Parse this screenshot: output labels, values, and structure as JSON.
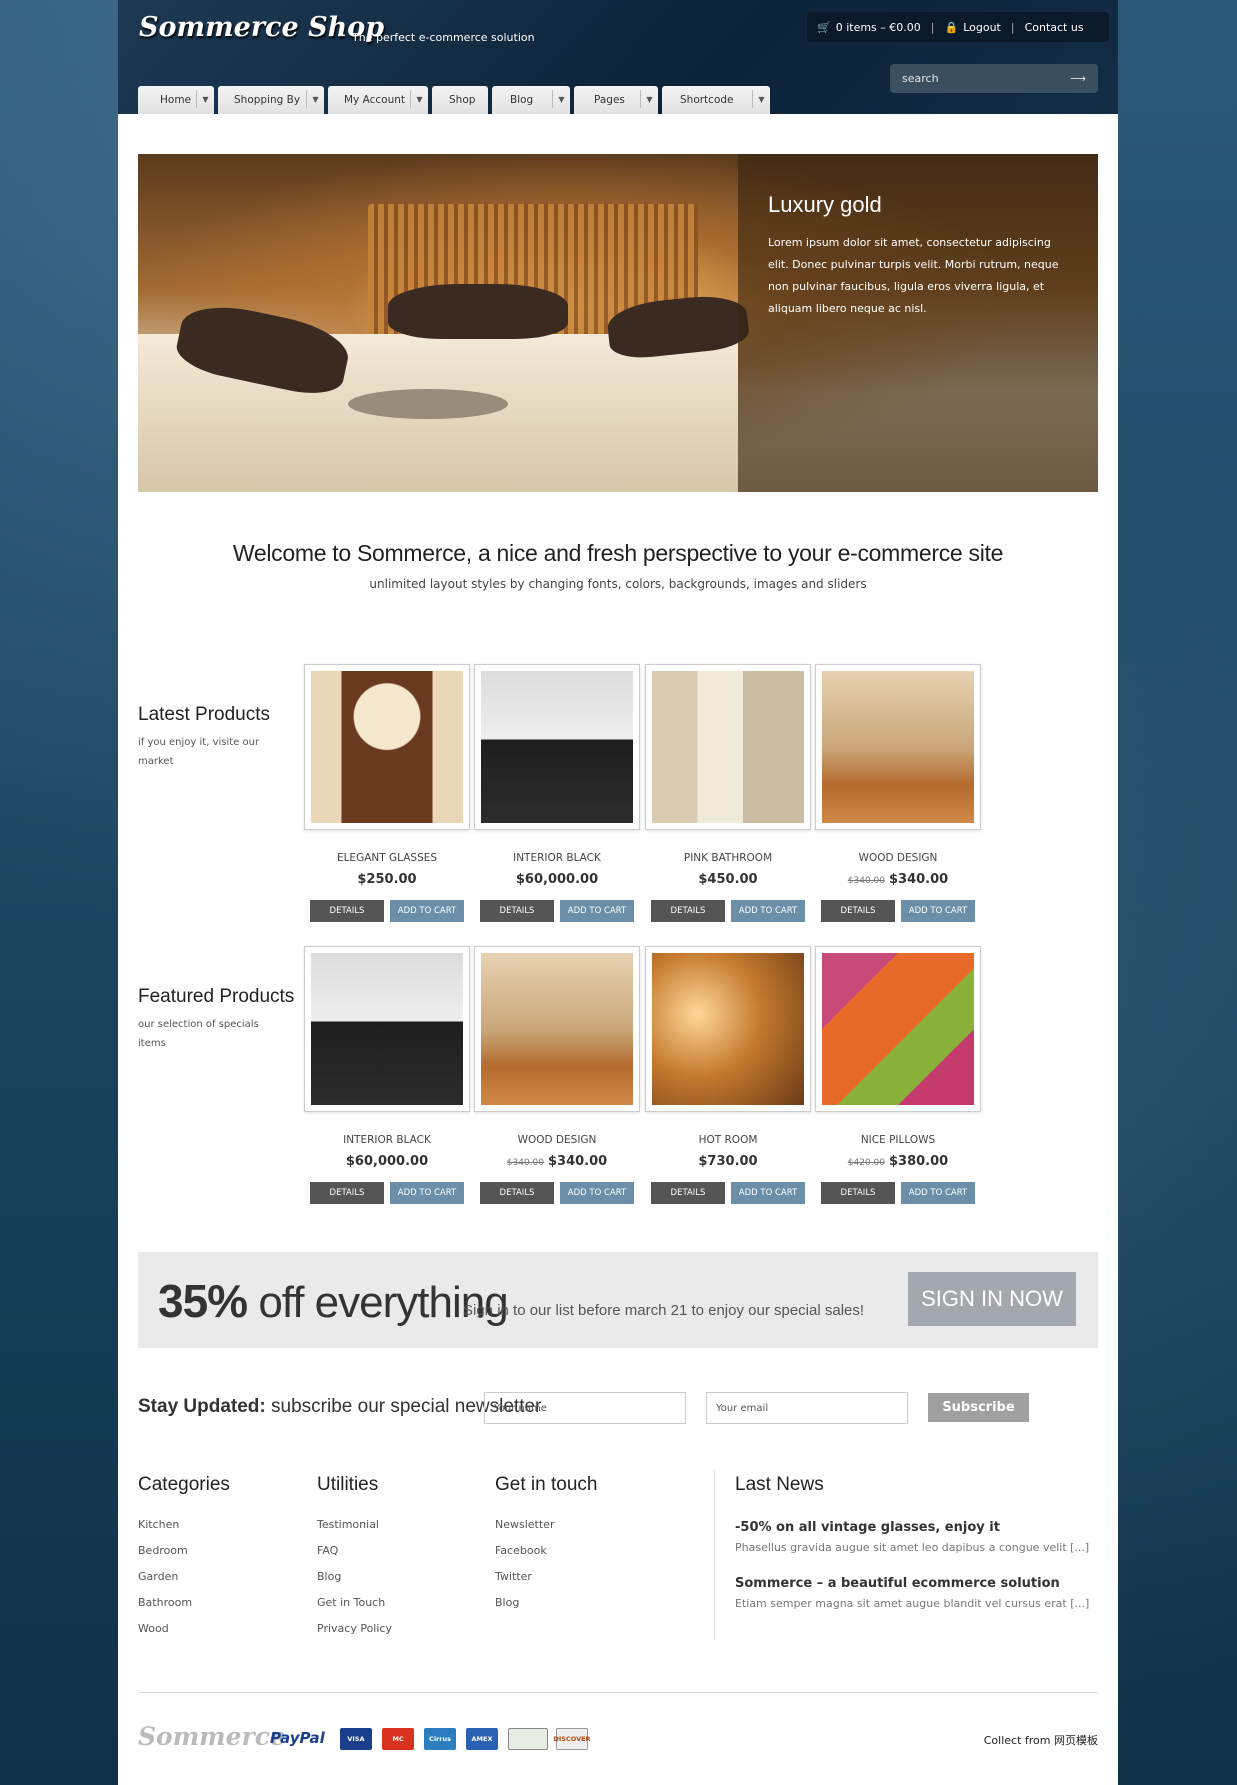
{
  "header": {
    "logo": "Sommerce Shop",
    "tagline": "The perfect e-commerce solution",
    "cart": "0 items – €0.00",
    "logout": "Logout",
    "contact": "Contact us",
    "search_placeholder": "search"
  },
  "nav": [
    "Home",
    "Shopping By",
    "My Account",
    "Shop",
    "Blog",
    "Pages",
    "Shortcode"
  ],
  "slider": {
    "title": "Luxury gold",
    "text": "Lorem ipsum dolor sit amet, consectetur adipiscing elit. Donec pulvinar turpis velit. Morbi rutrum, neque non pulvinar faucibus, ligula eros viverra ligula, et aliquam libero neque ac nisl."
  },
  "welcome": {
    "title": "Welcome to Sommerce, a nice and fresh perspective to your e-commerce site",
    "subtitle": "unlimited layout styles by changing fonts, colors, backgrounds, images and sliders"
  },
  "latest": {
    "title": "Latest Products",
    "subtitle": "if you enjoy it, visite our market",
    "items": [
      {
        "name": "ELEGANT GLASSES",
        "old": "",
        "price": "$250.00",
        "icon": "mirror-sink-image"
      },
      {
        "name": "INTERIOR BLACK",
        "old": "",
        "price": "$60,000.00",
        "icon": "black-bed-image"
      },
      {
        "name": "PINK BATHROOM",
        "old": "",
        "price": "$450.00",
        "icon": "bathroom-image"
      },
      {
        "name": "WOOD DESIGN",
        "old": "$340.00",
        "price": "$340.00",
        "icon": "living-room-image"
      }
    ]
  },
  "featured": {
    "title": "Featured Products",
    "subtitle": "our selection of specials items",
    "items": [
      {
        "name": "INTERIOR BLACK",
        "old": "",
        "price": "$60,000.00",
        "icon": "black-bed-image"
      },
      {
        "name": "WOOD DESIGN",
        "old": "$340.00",
        "price": "$340.00",
        "icon": "living-room-image"
      },
      {
        "name": "HOT ROOM",
        "old": "",
        "price": "$730.00",
        "icon": "hot-room-image"
      },
      {
        "name": "NICE PILLOWS",
        "old": "$420.00",
        "price": "$380.00",
        "icon": "pillows-image"
      }
    ]
  },
  "buttons": {
    "details": "DETAILS",
    "add": "ADD TO CART"
  },
  "promo": {
    "percent": "35%",
    "off": "off everything",
    "text": "Sign in to our list before march 21 to enjoy our special sales!",
    "button": "SIGN IN NOW"
  },
  "newsletter": {
    "bold": "Stay Updated:",
    "rest": "subscribe our special newsletter",
    "name_placeholder": "Your name",
    "email_placeholder": "Your email",
    "button": "Subscribe"
  },
  "footer": {
    "categories": {
      "title": "Categories",
      "items": [
        "Kitchen",
        "Bedroom",
        "Garden",
        "Bathroom",
        "Wood"
      ]
    },
    "utilities": {
      "title": "Utilities",
      "items": [
        "Testimonial",
        "FAQ",
        "Blog",
        "Get in Touch",
        "Privacy Policy"
      ]
    },
    "touch": {
      "title": "Get in touch",
      "items": [
        "Newsletter",
        "Facebook",
        "Twitter",
        "Blog"
      ]
    },
    "news": {
      "title": "Last News",
      "items": [
        {
          "title": "-50% on all vintage glasses, enjoy it",
          "desc": "Phasellus gravida augue sit amet leo dapibus a congue velit [...]"
        },
        {
          "title": "Sommerce – a beautiful ecommerce solution",
          "desc": "Etiam semper magna sit amet augue blandit vel cursus erat [...]"
        }
      ]
    },
    "logo": "Sommerce",
    "paypal": "PayPal",
    "cards": [
      "VISA",
      "MC",
      "Cirrus",
      "AMEX",
      "",
      "DISCOVER"
    ],
    "collect": "Collect from 网页模板"
  },
  "colors": {
    "accent": "#6b8fa8",
    "dark": "#0c2238",
    "button_dark": "#555555"
  }
}
